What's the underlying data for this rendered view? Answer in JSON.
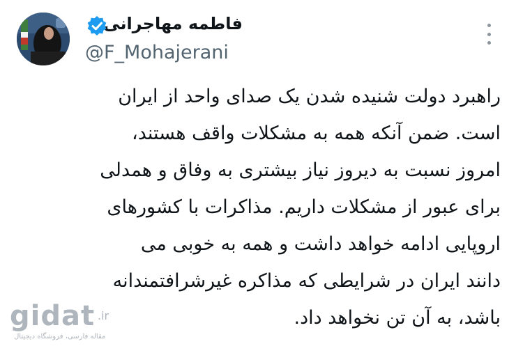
{
  "author": {
    "display_name": "فاطمه مهاجرانی",
    "handle": "@F_Mohajerani",
    "verified": true
  },
  "menu": {
    "icon": "more-dots-vertical-icon"
  },
  "tweet": {
    "lines": [
      "راهبرد دولت شنیده شدن یک صدای واحد از ایران",
      "است. ضمن آنکه همه به مشکلات واقف هستند،",
      "امروز نسبت به دیروز نیاز بیشتری به وفاق و همدلی",
      "برای عبور از مشکلات داریم. مذاکرات با کشورهای",
      "اروپایی ادامه خواهد داشت و همه به خوبی می",
      "دانند ایران در شرایطی که مذاکره غیرشرافتمندانه",
      "باشد، به آن تن نخواهد داد."
    ]
  },
  "watermark": {
    "logo": "gidat",
    "tld": ".ir",
    "tagline": "مقاله فارسی، فروشگاه دیجیتال"
  },
  "colors": {
    "verified_blue": "#1d9bf0",
    "handle_gray": "#536471",
    "text": "#0f1419"
  }
}
